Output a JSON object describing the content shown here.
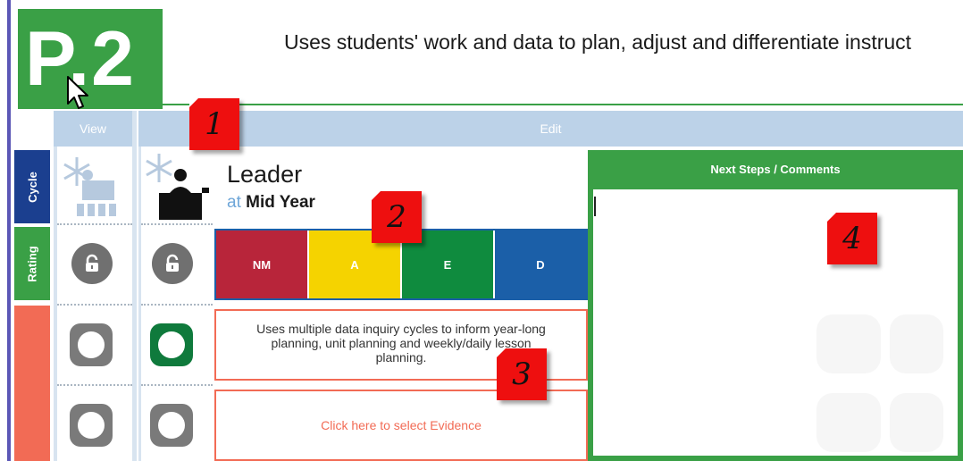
{
  "header": {
    "logo_text": "P.2",
    "subtitle": "Uses students' work and data to plan, adjust and differentiate instruct"
  },
  "columns": {
    "view": "View",
    "edit": "Edit"
  },
  "side_tabs": {
    "cycle": "Cycle",
    "rating": "Rating"
  },
  "leader": {
    "title": "Leader",
    "at": "at",
    "period": "Mid Year"
  },
  "ratings": [
    {
      "label": "NM",
      "color": "#b8253a"
    },
    {
      "label": "A",
      "color": "#f5d300"
    },
    {
      "label": "E",
      "color": "#0f8b3e"
    },
    {
      "label": "D",
      "color": "#1b5fa8"
    }
  ],
  "descriptor": "Uses multiple data inquiry cycles to inform year-long planning, unit planning and weekly/daily lesson planning.",
  "evidence_prompt": "Click here to select Evidence",
  "next_steps": {
    "header": "Next Steps / Comments",
    "value": ""
  },
  "callouts": [
    "1",
    "2",
    "3",
    "4"
  ],
  "colors": {
    "green": "#3aa046",
    "blue_dark": "#1b3f8f",
    "orange": "#f26b55",
    "header_blue": "#bcd2e8",
    "callout_red": "#ee0f0f"
  },
  "icons": [
    "arrow-cursor-icon",
    "snowflake-teacher-icon",
    "unlock-icon",
    "status-octagon-icon",
    "teacher-at-desk-icon"
  ]
}
